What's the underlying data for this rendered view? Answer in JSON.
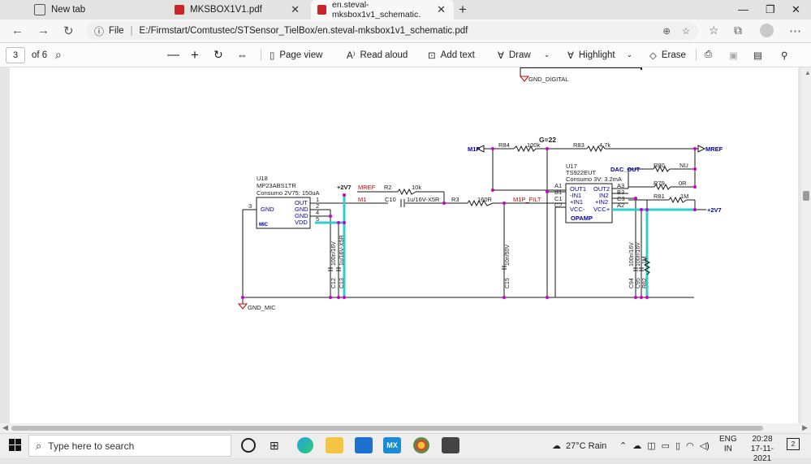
{
  "tabs": [
    {
      "title": "New tab",
      "icon": "page-icon"
    },
    {
      "title": "MKSBOX1V1.pdf",
      "icon": "pdf-icon"
    },
    {
      "title": "en.steval-mksbox1v1_schematic.",
      "icon": "pdf-icon",
      "active": true
    }
  ],
  "address": {
    "scheme_label": "File",
    "url": "E:/Firmstart/Comtustec/STSensor_TielBox/en.steval-mksbox1v1_schematic.pdf"
  },
  "toolbar": {
    "page_current": "3",
    "page_total": "of 6",
    "page_view": "Page view",
    "read_aloud": "Read aloud",
    "add_text": "Add text",
    "draw": "Draw",
    "highlight": "Highlight",
    "erase": "Erase"
  },
  "schematic": {
    "gnd_digital": "GND_DIGITAL",
    "gnd_mic": "GND_MIC",
    "gain": "G=22",
    "u18": {
      "ref": "U18",
      "part": "MP23ABS1TR",
      "consumo": "Consumo 2V75: 150uA",
      "pins": [
        "OUT",
        "GND",
        "GND",
        "VDD"
      ],
      "gnd_left": "GND",
      "mic": "MIC",
      "pin_nums": [
        "1",
        "2",
        "4",
        "5"
      ],
      "pin3": "3"
    },
    "u17": {
      "ref": "U17",
      "part": "TS922EUT",
      "consumo": "Consumo 3V: 3.2mA",
      "left_pins": [
        "OUT1",
        "-IN1",
        "+IN1",
        "VCC-"
      ],
      "right_pins": [
        "OUT2",
        "IN2",
        "+IN2",
        "VCC+"
      ],
      "left_balls": [
        "A1",
        "B1",
        "C1",
        "C2"
      ],
      "right_balls": [
        "A3",
        "B3",
        "C3",
        "A2"
      ],
      "label": "OPAMP"
    },
    "net_mip": "M1P",
    "net_mref": "MREF",
    "net_m1": "M1",
    "net_m1p_filt": "M1P_FILT",
    "net_dac_out": "DAC_OUT",
    "net_mref_right": "MREF",
    "net_2v7_top": "+2V7",
    "net_2v7_right": "+2V7",
    "r84": "R84",
    "r84v": "100k",
    "r83": "R83",
    "r83v": "4.7k",
    "r80": "R80",
    "r80v": "NU",
    "r79": "R79",
    "r79v": "0R",
    "r81": "R81",
    "r81v": "1M",
    "r2": "R2",
    "r2v": "10k",
    "c10": "C10",
    "c10v": "1u/16V-X5R",
    "r3": "R3",
    "r3v": "160R",
    "c12": "C12",
    "c12v": "100n/16V",
    "c13": "C13",
    "c13v": "1u/16V-X5R",
    "c15": "C15",
    "c15v": "10n/50V",
    "c94": "C94",
    "c94v": "100n/16V",
    "c95": "C95",
    "c95v": "100n/16V",
    "r82": "R82",
    "r82v": "1M"
  },
  "taskbar": {
    "search_placeholder": "Type here to search",
    "weather": "27°C  Rain",
    "lang_top": "ENG",
    "lang_bottom": "IN",
    "time": "20:28",
    "date": "17-11-2021",
    "notif_count": "2"
  },
  "colors": {
    "wire": "#1a1a1a",
    "net_label": "#cc0000",
    "junction": "#cc00cc",
    "hl_wire": "#33cccc",
    "power": "#cc0000"
  }
}
